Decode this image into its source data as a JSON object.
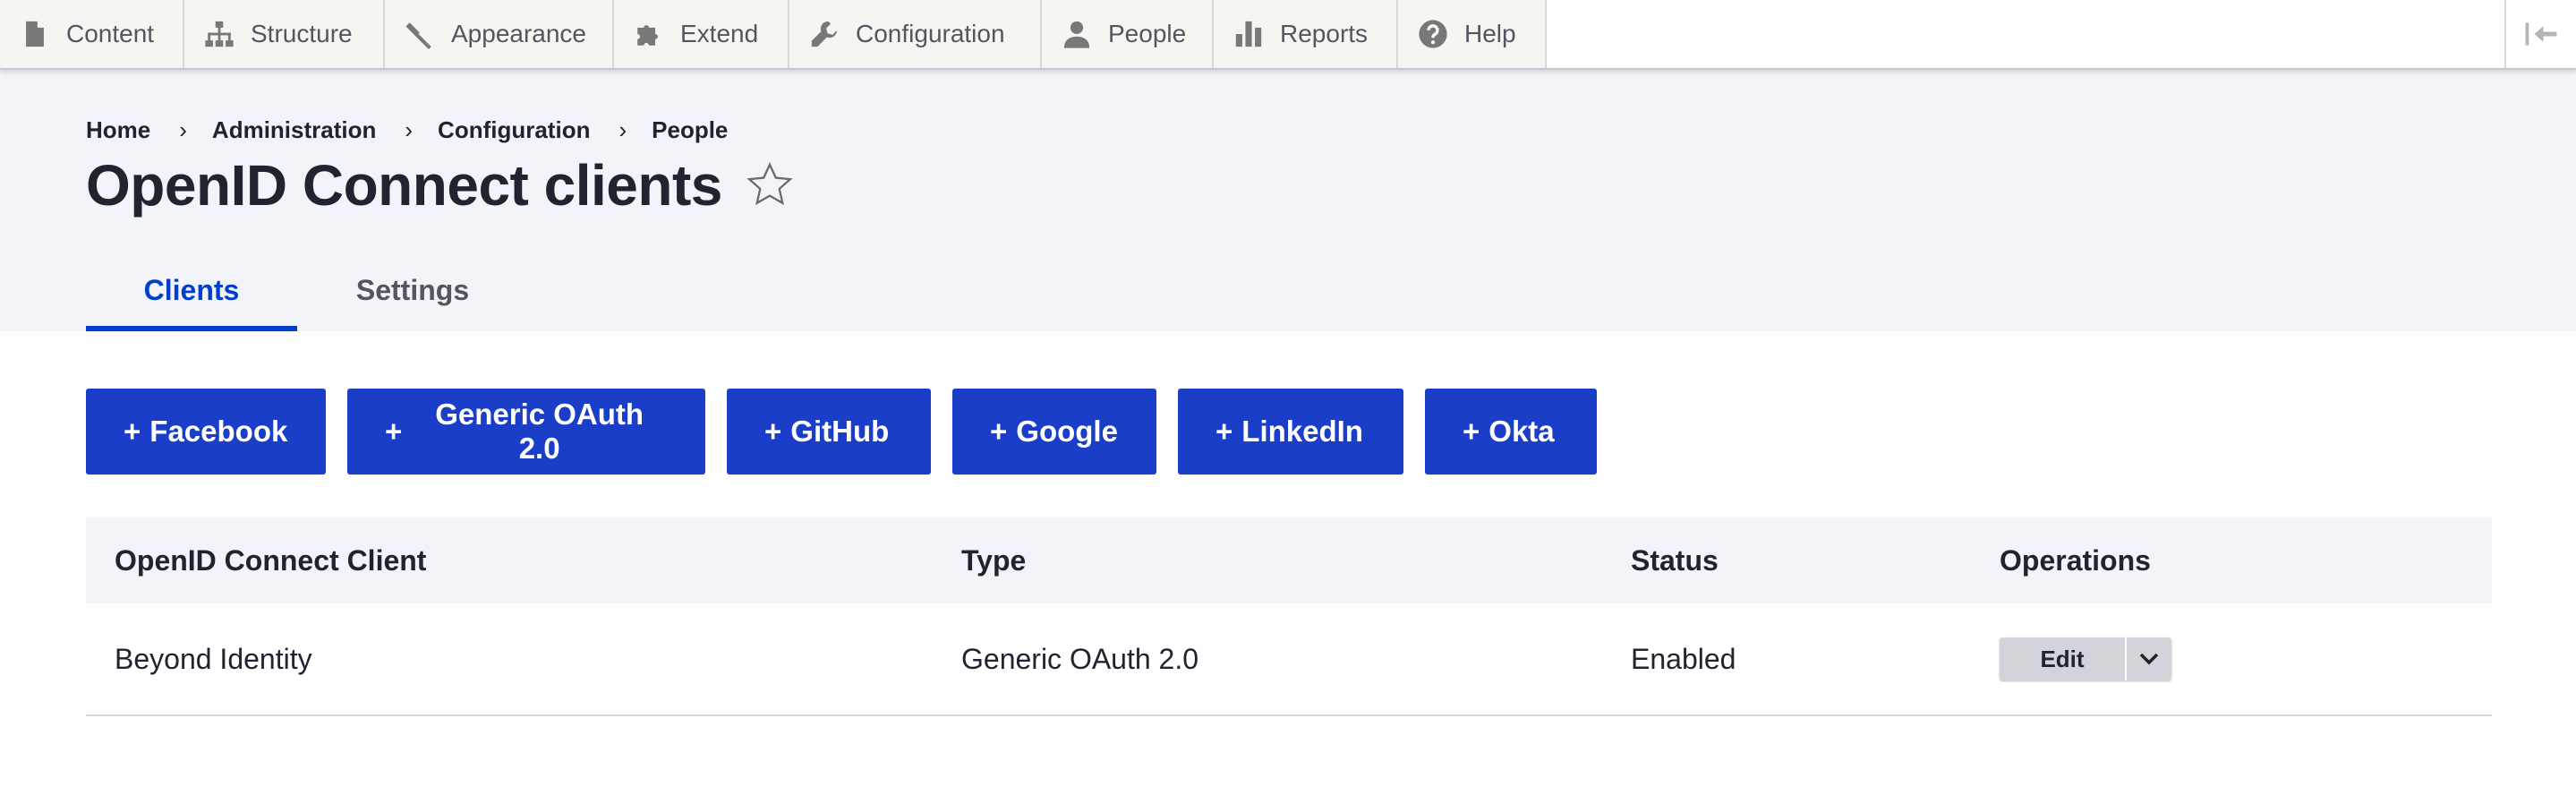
{
  "toolbar": {
    "items": [
      {
        "label": "Content",
        "icon": "file-icon"
      },
      {
        "label": "Structure",
        "icon": "sitemap-icon"
      },
      {
        "label": "Appearance",
        "icon": "paint-icon"
      },
      {
        "label": "Extend",
        "icon": "puzzle-icon"
      },
      {
        "label": "Configuration",
        "icon": "wrench-icon"
      },
      {
        "label": "People",
        "icon": "person-icon"
      },
      {
        "label": "Reports",
        "icon": "bar-chart-icon"
      },
      {
        "label": "Help",
        "icon": "help-icon"
      }
    ],
    "collapse_icon": "collapse-sidebar-icon"
  },
  "breadcrumb": [
    "Home",
    "Administration",
    "Configuration",
    "People"
  ],
  "page_title": "OpenID Connect clients",
  "tabs": [
    {
      "label": "Clients",
      "active": true
    },
    {
      "label": "Settings",
      "active": false
    }
  ],
  "buttons": [
    {
      "label": "Facebook"
    },
    {
      "label": "Generic OAuth 2.0"
    },
    {
      "label": "GitHub"
    },
    {
      "label": "Google"
    },
    {
      "label": "LinkedIn"
    },
    {
      "label": "Okta"
    }
  ],
  "button_prefix": "+",
  "table": {
    "headers": [
      "OpenID Connect Client",
      "Type",
      "Status",
      "Operations"
    ],
    "rows": [
      {
        "client": "Beyond Identity",
        "type": "Generic OAuth 2.0",
        "status": "Enabled",
        "operation": "Edit"
      }
    ]
  },
  "colors": {
    "accent": "#003ecc",
    "button": "#1b3ec8",
    "header_bg": "#f3f4f9"
  }
}
